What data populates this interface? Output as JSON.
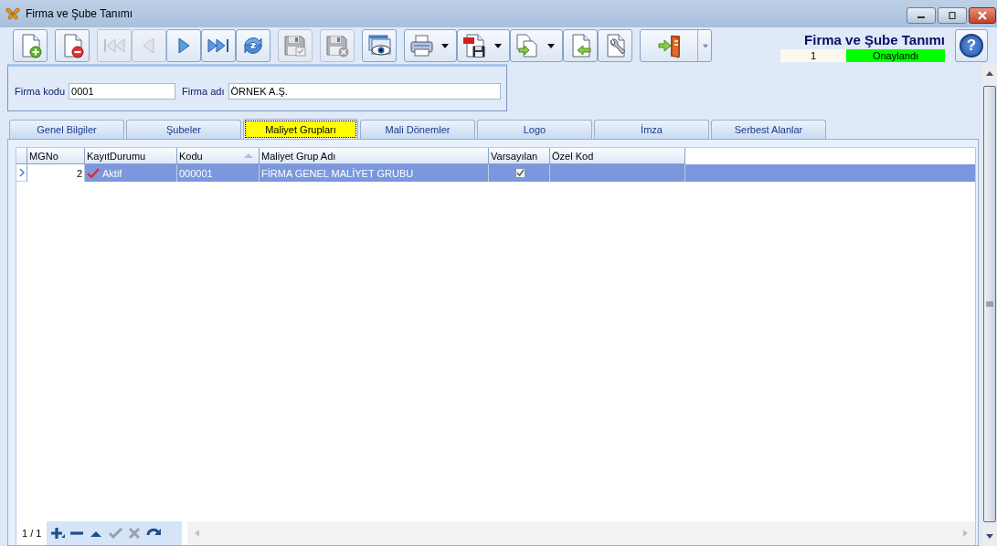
{
  "window": {
    "title": "Firma ve Şube Tanımı"
  },
  "toolbar": [
    [
      {
        "kind": "new",
        "disabled": false,
        "dropdown": false
      }
    ],
    [
      {
        "kind": "delete",
        "disabled": false,
        "dropdown": false
      }
    ],
    [
      {
        "kind": "first",
        "disabled": true,
        "dropdown": false
      },
      {
        "kind": "previous",
        "disabled": true,
        "dropdown": false
      },
      {
        "kind": "next",
        "disabled": false,
        "dropdown": false
      },
      {
        "kind": "last",
        "disabled": false,
        "dropdown": false
      },
      {
        "kind": "refresh",
        "disabled": false,
        "dropdown": false
      }
    ],
    [
      {
        "kind": "save",
        "disabled": true,
        "dropdown": false
      }
    ],
    [
      {
        "kind": "cancel",
        "disabled": true,
        "dropdown": false
      }
    ],
    [
      {
        "kind": "preview",
        "disabled": false,
        "dropdown": false
      }
    ],
    [
      {
        "kind": "print",
        "disabled": false,
        "dropdown": true
      },
      {
        "kind": "pdf",
        "disabled": false,
        "dropdown": true
      },
      {
        "kind": "export",
        "disabled": false,
        "dropdown": true
      },
      {
        "kind": "import",
        "disabled": false,
        "dropdown": false
      },
      {
        "kind": "tools",
        "disabled": false,
        "dropdown": false
      }
    ],
    [
      {
        "kind": "exit",
        "disabled": false,
        "dropdown": true
      }
    ]
  ],
  "header": {
    "title": "Firma ve Şube Tanımı",
    "record": "1",
    "status": "Onaylandı",
    "help": "?"
  },
  "company": {
    "fields": [
      {
        "label": "Firma kodu",
        "value": "0001"
      },
      {
        "label": "Firma adı",
        "value": "ÖRNEK A.Ş."
      }
    ]
  },
  "tabs": [
    {
      "label": "Genel Bilgiler",
      "selected": false
    },
    {
      "label": "Şubeler",
      "selected": false
    },
    {
      "label": "Maliyet Grupları",
      "selected": true
    },
    {
      "label": "Mali Dönemler",
      "selected": false
    },
    {
      "label": "Logo",
      "selected": false
    },
    {
      "label": "İmza",
      "selected": false
    },
    {
      "label": "Serbest Alanlar",
      "selected": false
    }
  ],
  "table": {
    "columns": [
      {
        "label": "MGNo",
        "sorted": false
      },
      {
        "label": "KayıtDurumu",
        "sorted": false
      },
      {
        "label": "Kodu",
        "sorted": true
      },
      {
        "label": "Maliyet Grup Adı",
        "sorted": false
      },
      {
        "label": "Varsayılan",
        "sorted": false
      },
      {
        "label": "Özel Kod",
        "sorted": false
      }
    ],
    "rows": [
      {
        "selected": true,
        "mgno": "2",
        "status": "Aktif",
        "active": true,
        "code": "000001",
        "name": "FİRMA GENEL MALİYET GRUBU",
        "default": true
      }
    ]
  },
  "navigator": {
    "position": "1 / 1",
    "buttons": [
      {
        "kind": "add",
        "disabled": false
      },
      {
        "kind": "remove",
        "disabled": false
      },
      {
        "kind": "up",
        "disabled": false
      },
      {
        "kind": "confirm",
        "disabled": true
      },
      {
        "kind": "discard",
        "disabled": true
      },
      {
        "kind": "redo",
        "disabled": false
      }
    ]
  }
}
